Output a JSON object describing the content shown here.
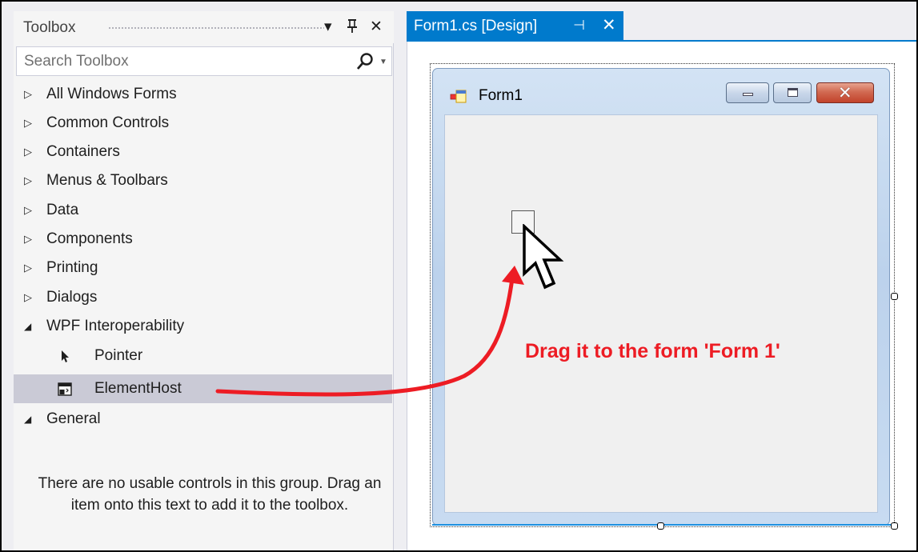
{
  "toolbox": {
    "title": "Toolbox",
    "dropdown_glyph": "▾",
    "pin_glyph": "⊥",
    "close_glyph": "✕",
    "search_placeholder": "Search Toolbox",
    "search_icon": "search-icon",
    "groups": [
      {
        "label": "All Windows Forms",
        "expanded": false,
        "arrow": "▷"
      },
      {
        "label": "Common Controls",
        "expanded": false,
        "arrow": "▷"
      },
      {
        "label": "Containers",
        "expanded": false,
        "arrow": "▷"
      },
      {
        "label": "Menus & Toolbars",
        "expanded": false,
        "arrow": "▷"
      },
      {
        "label": "Data",
        "expanded": false,
        "arrow": "▷"
      },
      {
        "label": "Components",
        "expanded": false,
        "arrow": "▷"
      },
      {
        "label": "Printing",
        "expanded": false,
        "arrow": "▷"
      },
      {
        "label": "Dialogs",
        "expanded": false,
        "arrow": "▷"
      },
      {
        "label": "WPF Interoperability",
        "expanded": true,
        "arrow": "◢"
      }
    ],
    "wpf_items": [
      {
        "label": "Pointer",
        "icon": "pointer-icon",
        "selected": false
      },
      {
        "label": "ElementHost",
        "icon": "elementhost-icon",
        "selected": true
      }
    ],
    "general_group": {
      "label": "General",
      "arrow": "◢"
    },
    "empty_message": "There are no usable controls in this group. Drag an item onto this text to add it to the toolbox."
  },
  "document_tab": {
    "label": "Form1.cs [Design]",
    "pin_glyph": "⊣",
    "close_glyph": "✕",
    "accent_color": "#007acc"
  },
  "designer": {
    "form_title": "Form1",
    "annotation": "Drag it to the form 'Form 1'",
    "annotation_color": "#ed1c24",
    "close_glyph": "✕"
  }
}
